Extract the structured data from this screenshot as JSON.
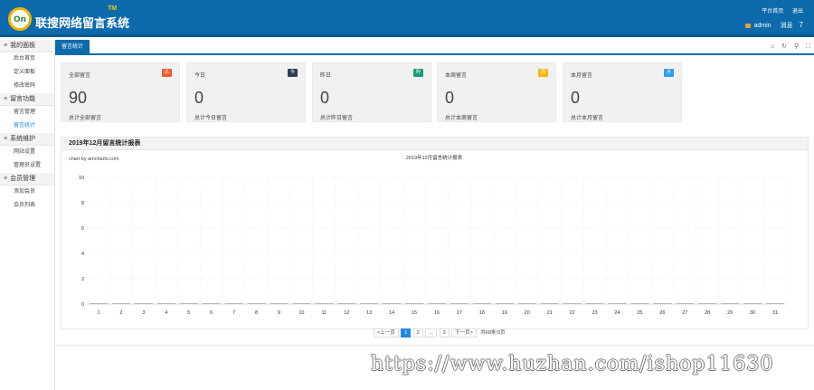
{
  "header": {
    "brand": "联搜网络留言系统",
    "tm": "TM",
    "links": [
      "平台首页",
      "退出"
    ],
    "user": "admin",
    "message_label": "消息",
    "message_count": "7",
    "logo_text": "On"
  },
  "sidebar": {
    "groups": [
      {
        "label": "我的面板",
        "items": [
          "后台首页",
          "定义面板",
          "修改密码"
        ]
      },
      {
        "label": "留言功能",
        "items": [
          "留言管理",
          "留言统计"
        ]
      },
      {
        "label": "系统维护",
        "items": [
          "网站设置",
          "管理员设置"
        ]
      },
      {
        "label": "会员管理",
        "items": [
          "添加会员",
          "会员列表"
        ]
      }
    ],
    "active_item": "留言统计"
  },
  "tabs": {
    "active": "留言统计"
  },
  "stats": [
    {
      "title": "全部留言",
      "badge": "总",
      "badge_color": "#ef5b2f",
      "value": "0",
      "display": "90",
      "desc": "总计全部留言"
    },
    {
      "title": "今日",
      "badge": "今",
      "badge_color": "#2f3e50",
      "value": "0",
      "display": "0",
      "desc": "总计今日留言"
    },
    {
      "title": "昨日",
      "badge": "昨",
      "badge_color": "#1e9a7a",
      "value": "0",
      "display": "0",
      "desc": "总计昨日留言"
    },
    {
      "title": "本周留言",
      "badge": "周",
      "badge_color": "#f2b80c",
      "value": "0",
      "display": "0",
      "desc": "总计本周留言"
    },
    {
      "title": "本月留言",
      "badge": "月",
      "badge_color": "#2d9bf0",
      "value": "0",
      "display": "0",
      "desc": "总计本月留言"
    }
  ],
  "panel": {
    "title": "2019年12月留言统计报表",
    "credit": "chart by amcharts.com"
  },
  "chart_data": {
    "type": "bar",
    "title": "2019年12月留言统计报表",
    "categories": [
      "1",
      "2",
      "3",
      "4",
      "5",
      "6",
      "7",
      "8",
      "9",
      "10",
      "11",
      "12",
      "13",
      "14",
      "15",
      "16",
      "17",
      "18",
      "19",
      "20",
      "21",
      "22",
      "23",
      "24",
      "25",
      "26",
      "27",
      "28",
      "29",
      "30",
      "31"
    ],
    "values": [
      0,
      0,
      0,
      0,
      0,
      0,
      0,
      0,
      0,
      0,
      0,
      0,
      0,
      0,
      0,
      0,
      0,
      0,
      0,
      0,
      0,
      0,
      0,
      0,
      0,
      0,
      0,
      0,
      0,
      0,
      0
    ],
    "ylim": [
      0,
      10
    ],
    "yticks": [
      0,
      2,
      4,
      6,
      8,
      10
    ],
    "grid": true,
    "bar_color": "#a8a8a8"
  },
  "pagination": {
    "prev": "<上一页",
    "pages": [
      "1",
      "2",
      "...",
      "3"
    ],
    "current": "1",
    "next": "下一页>",
    "info": "共68条/3页"
  },
  "watermark": "https://www.huzhan.com/ishop11630"
}
